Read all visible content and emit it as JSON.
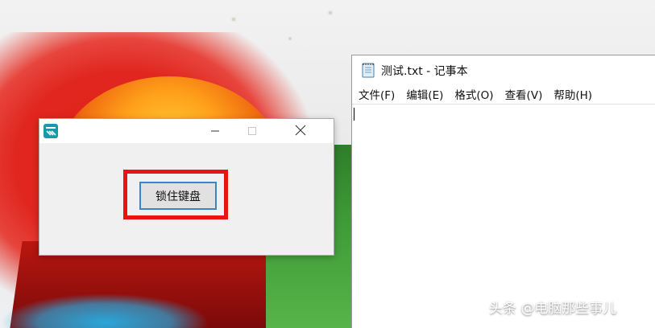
{
  "desktop": {
    "watermark": "头条 @电脑那些事儿"
  },
  "app_window": {
    "icon": "app-logo-icon",
    "controls": {
      "minimize_icon": "minimize-icon",
      "maximize_icon": "maximize-icon",
      "close_icon": "close-icon"
    },
    "lock_button_label": "锁住键盘",
    "highlight_color": "#e81410"
  },
  "notepad": {
    "icon": "notepad-icon",
    "title": "测试.txt - 记事本",
    "menu": [
      "文件(F)",
      "编辑(E)",
      "格式(O)",
      "查看(V)",
      "帮助(H)"
    ],
    "content": ""
  }
}
